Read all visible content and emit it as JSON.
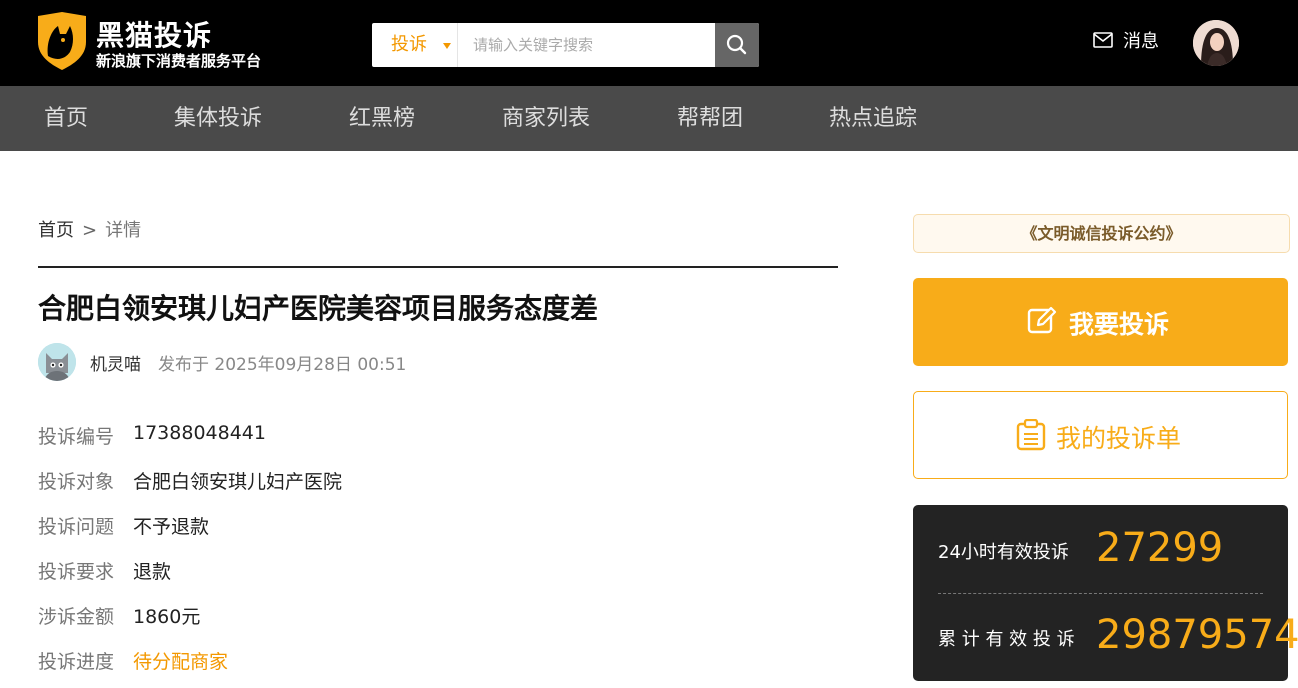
{
  "brand": {
    "title": "黑猫投诉",
    "subtitle": "新浪旗下消费者服务平台"
  },
  "search": {
    "type_label": "投诉",
    "placeholder": "请输入关键字搜索"
  },
  "header": {
    "message_label": "消息"
  },
  "nav": {
    "items": [
      {
        "label": "首页"
      },
      {
        "label": "集体投诉"
      },
      {
        "label": "红黑榜"
      },
      {
        "label": "商家列表"
      },
      {
        "label": "帮帮团"
      },
      {
        "label": "热点追踪"
      }
    ]
  },
  "breadcrumb": {
    "home": "首页",
    "separator": ">",
    "current": "详情"
  },
  "complaint": {
    "title": "合肥白领安琪儿妇产医院美容项目服务态度差",
    "author": "机灵喵",
    "published": "发布于 2025年09月28日 00:51",
    "fields": [
      {
        "label": "投诉编号",
        "value": "17388048441"
      },
      {
        "label": "投诉对象",
        "value": "合肥白领安琪儿妇产医院"
      },
      {
        "label": "投诉问题",
        "value": "不予退款"
      },
      {
        "label": "投诉要求",
        "value": "退款"
      },
      {
        "label": "涉诉金额",
        "value": "1860元"
      },
      {
        "label": "投诉进度",
        "value": "待分配商家"
      }
    ]
  },
  "sidebar": {
    "pact_label": "《文明诚信投诉公约》",
    "complain_button": "我要投诉",
    "my_complaints_button": "我的投诉单",
    "stats": [
      {
        "label": "24小时有效投诉",
        "value": "27299"
      },
      {
        "label": "累 计 有 效 投 诉",
        "value": "29879574"
      }
    ]
  },
  "colors": {
    "accent": "#f8ac19",
    "header_bg": "#000000",
    "nav_bg": "#4a4a4a",
    "stats_bg": "#232323"
  }
}
